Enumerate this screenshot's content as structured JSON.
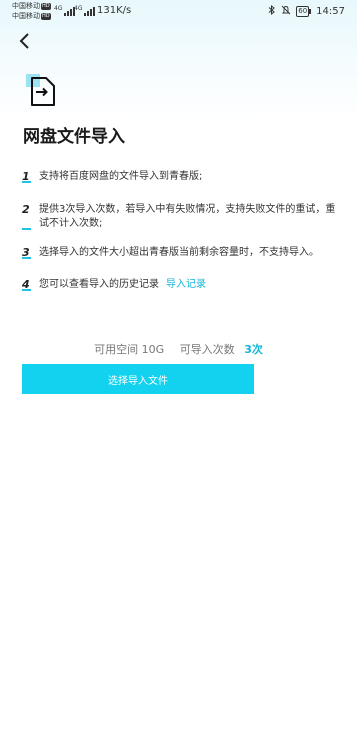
{
  "status_bar": {
    "carrier1": "中国移动",
    "carrier2": "中国移动",
    "hd_badge": "HD",
    "network1": "4G",
    "network2": "4G",
    "speed": "131K/s",
    "battery": "60",
    "time": "14:57",
    "icons": [
      "signal-icon",
      "bluetooth-icon",
      "mute-icon",
      "battery-icon"
    ]
  },
  "header": {
    "back_icon": "chevron-left-icon"
  },
  "page": {
    "icon": "file-import-icon",
    "title": "网盘文件导入"
  },
  "rules": [
    {
      "num": "1",
      "text": "支持将百度网盘的文件导入到青春版;"
    },
    {
      "num": "2",
      "text": "提供3次导入次数，若导入中有失败情况，支持失败文件的重试，重试不计入次数;"
    },
    {
      "num": "3",
      "text": "选择导入的文件大小超出青春版当前剩余容量时，不支持导入。"
    },
    {
      "num": "4",
      "text": "您可以查看导入的历史记录",
      "link": "导入记录"
    }
  ],
  "quota": {
    "space_label": "可用空间",
    "space_value": "10G",
    "count_label": "可导入次数",
    "count_value": "3次"
  },
  "action": {
    "select_label": "选择导入文件"
  },
  "colors": {
    "accent": "#13b6d9",
    "button": "#13d2ef",
    "rule_marker": "#21c4e0"
  }
}
